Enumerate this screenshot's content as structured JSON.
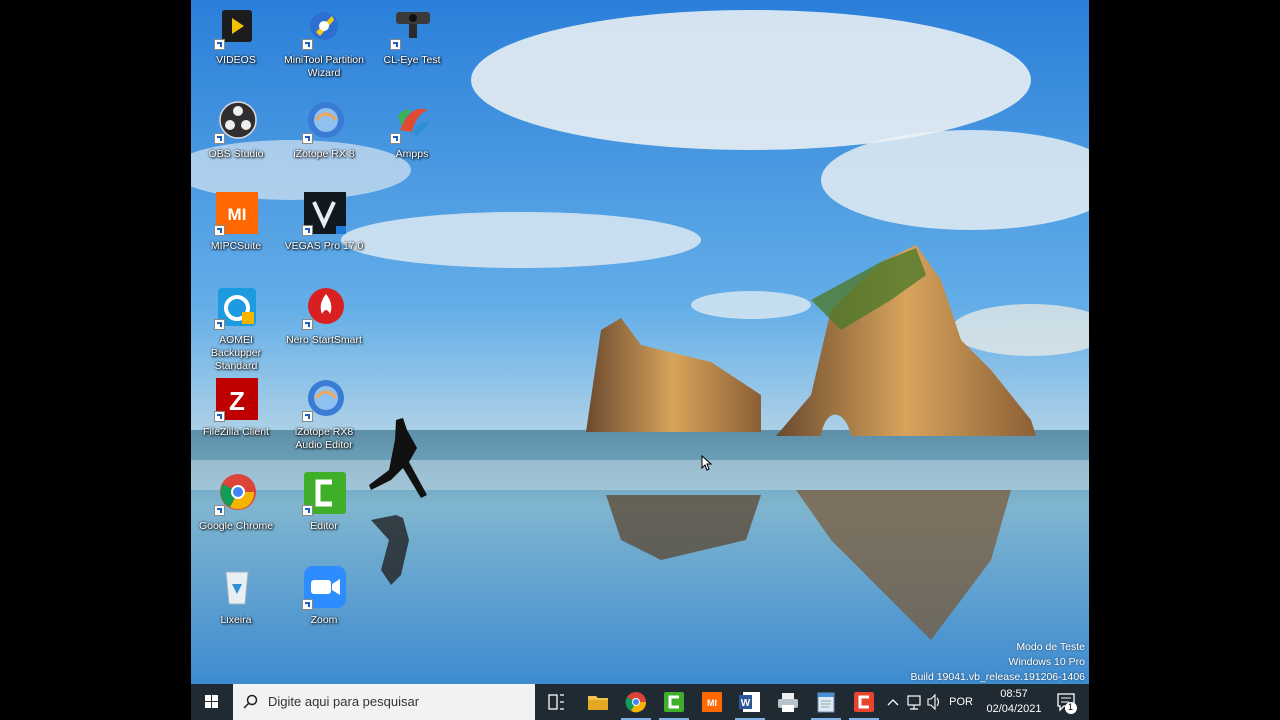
{
  "desktop": {
    "icons": [
      {
        "label": "VIDEOS",
        "icon": "video-player-icon",
        "color": "#f2c200"
      },
      {
        "label": "MiniTool Partition Wizard",
        "icon": "partition-wizard-icon",
        "color": "#2c6fd1"
      },
      {
        "label": "CL-Eye Test",
        "icon": "webcam-icon",
        "color": "#333333"
      },
      {
        "label": "OBS Studio",
        "icon": "obs-icon",
        "color": "#302e31"
      },
      {
        "label": "iZotope RX 8",
        "icon": "izotope-icon",
        "color": "#3a7bd5"
      },
      {
        "label": "Ampps",
        "icon": "ampps-icon",
        "color": "#e04a2f"
      },
      {
        "label": "MIPCSuite",
        "icon": "mi-icon",
        "color": "#ff6700"
      },
      {
        "label": "VEGAS Pro 17.0",
        "icon": "vegas-icon",
        "color": "#101820"
      },
      {
        "label": "AOMEI Backupper Standard",
        "icon": "aomei-icon",
        "color": "#1e9be0"
      },
      {
        "label": "Nero StartSmart",
        "icon": "nero-icon",
        "color": "#d82020"
      },
      {
        "label": "FileZilla Client",
        "icon": "filezilla-icon",
        "color": "#bf0000"
      },
      {
        "label": "iZotope RX8 Audio Editor",
        "icon": "izotope-icon",
        "color": "#3a7bd5"
      },
      {
        "label": "Google Chrome",
        "icon": "chrome-icon",
        "color": "#4285f4"
      },
      {
        "label": "Editor",
        "icon": "camtasia-icon",
        "color": "#3fae29"
      },
      {
        "label": "Lixeira",
        "icon": "recycle-bin-icon",
        "color": "#dfe8ee"
      },
      {
        "label": "Zoom",
        "icon": "zoom-icon",
        "color": "#2d8cff"
      }
    ]
  },
  "watermark": {
    "line1": "Modo de Teste",
    "line2": "Windows 10 Pro",
    "line3": "Build 19041.vb_release.191206-1406"
  },
  "taskbar": {
    "search_placeholder": "Digite aqui para pesquisar",
    "apps": [
      "task-view-icon",
      "file-explorer-icon",
      "chrome-icon",
      "camtasia-icon",
      "mi-icon",
      "word-icon",
      "printer-icon",
      "notepad-icon",
      "camtasia-recorder-icon"
    ],
    "tray": {
      "language": "POR",
      "time": "08:57",
      "date": "02/04/2021",
      "notifications": "1"
    }
  }
}
